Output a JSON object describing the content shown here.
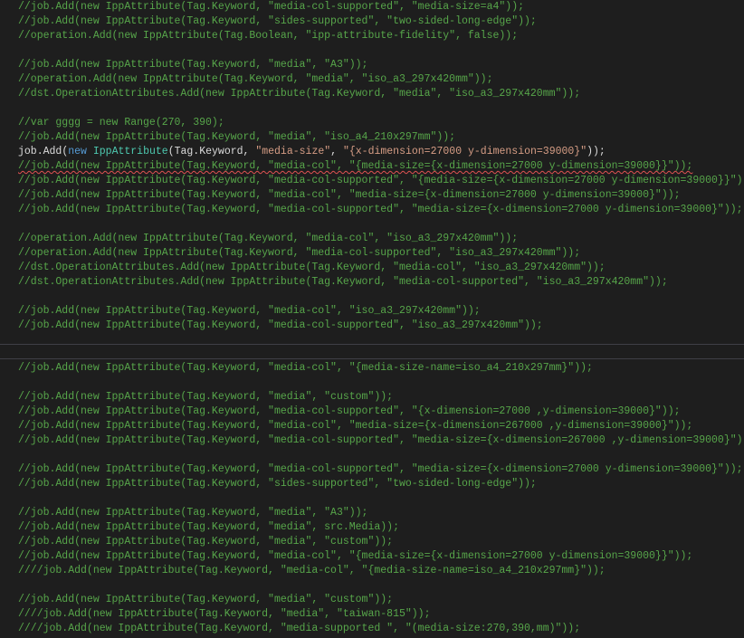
{
  "top_pane": {
    "lines": [
      "//job.Add(new IppAttribute(Tag.Keyword, \"media-col-supported\", \"media-size=a4\"));",
      "//job.Add(new IppAttribute(Tag.Keyword, \"sides-supported\", \"two-sided-long-edge\"));",
      "//operation.Add(new IppAttribute(Tag.Boolean, \"ipp-attribute-fidelity\", false));",
      "",
      "//job.Add(new IppAttribute(Tag.Keyword, \"media\", \"A3\"));",
      "//operation.Add(new IppAttribute(Tag.Keyword, \"media\", \"iso_a3_297x420mm\"));",
      "//dst.OperationAttributes.Add(new IppAttribute(Tag.Keyword, \"media\", \"iso_a3_297x420mm\"));",
      "",
      "//var gggg = new Range(270, 390);",
      "//job.Add(new IppAttribute(Tag.Keyword, \"media\", \"iso_a4_210x297mm\"));",
      "",
      "//job.Add(new IppAttribute(Tag.Keyword, \"media-col\", \"{media-size={x-dimension=27000 y-dimension=39000}}\"));",
      "//job.Add(new IppAttribute(Tag.Keyword, \"media-col-supported\", \"{media-size={x-dimension=27000 y-dimension=39000}}\"));",
      "//job.Add(new IppAttribute(Tag.Keyword, \"media-col\", \"media-size={x-dimension=27000 y-dimension=39000}\"));",
      "//job.Add(new IppAttribute(Tag.Keyword, \"media-col-supported\", \"media-size={x-dimension=27000 y-dimension=39000}\"));",
      "",
      "//operation.Add(new IppAttribute(Tag.Keyword, \"media-col\", \"iso_a3_297x420mm\"));",
      "//operation.Add(new IppAttribute(Tag.Keyword, \"media-col-supported\", \"iso_a3_297x420mm\"));",
      "//dst.OperationAttributes.Add(new IppAttribute(Tag.Keyword, \"media-col\", \"iso_a3_297x420mm\"));",
      "//dst.OperationAttributes.Add(new IppAttribute(Tag.Keyword, \"media-col-supported\", \"iso_a3_297x420mm\"));",
      "",
      "//job.Add(new IppAttribute(Tag.Keyword, \"media-col\", \"iso_a3_297x420mm\"));",
      "//job.Add(new IppAttribute(Tag.Keyword, \"media-col-supported\", \"iso_a3_297x420mm\"));"
    ],
    "active_line": {
      "obj": "job",
      "method": "Add",
      "kw_new": "new",
      "cls": "IppAttribute",
      "args_open": "(Tag.Keyword, ",
      "str1": "\"media-size\"",
      "sep": ", ",
      "str2": "\"{x-dimension=27000 y-dimension=39000}\"",
      "close": "));"
    }
  },
  "bottom_pane": {
    "lines": [
      "//job.Add(new IppAttribute(Tag.Keyword, \"media-col\", \"{media-size-name=iso_a4_210x297mm}\"));",
      "",
      "//job.Add(new IppAttribute(Tag.Keyword, \"media\", \"custom\"));",
      "//job.Add(new IppAttribute(Tag.Keyword, \"media-col-supported\", \"{x-dimension=27000 ,y-dimension=39000}\"));",
      "//job.Add(new IppAttribute(Tag.Keyword, \"media-col\", \"media-size={x-dimension=267000 ,y-dimension=39000}\"));",
      "//job.Add(new IppAttribute(Tag.Keyword, \"media-col-supported\", \"media-size={x-dimension=267000 ,y-dimension=39000}\"));",
      "",
      "//job.Add(new IppAttribute(Tag.Keyword, \"media-col-supported\", \"media-size={x-dimension=27000 y-dimension=39000}\"));",
      "//job.Add(new IppAttribute(Tag.Keyword, \"sides-supported\", \"two-sided-long-edge\"));",
      "",
      "//job.Add(new IppAttribute(Tag.Keyword, \"media\", \"A3\"));",
      "//job.Add(new IppAttribute(Tag.Keyword, \"media\", src.Media));",
      "//job.Add(new IppAttribute(Tag.Keyword, \"media\", \"custom\"));",
      "//job.Add(new IppAttribute(Tag.Keyword, \"media-col\", \"{media-size={x-dimension=27000 y-dimension=39000}}\"));",
      "////job.Add(new IppAttribute(Tag.Keyword, \"media-col\", \"{media-size-name=iso_a4_210x297mm}\"));",
      "",
      "//job.Add(new IppAttribute(Tag.Keyword, \"media\", \"custom\"));",
      "////job.Add(new IppAttribute(Tag.Keyword, \"media\", \"taiwan-815\"));",
      "////job.Add(new IppAttribute(Tag.Keyword, \"media-supported \", \"(media-size:270,390,mm)\"));"
    ]
  }
}
